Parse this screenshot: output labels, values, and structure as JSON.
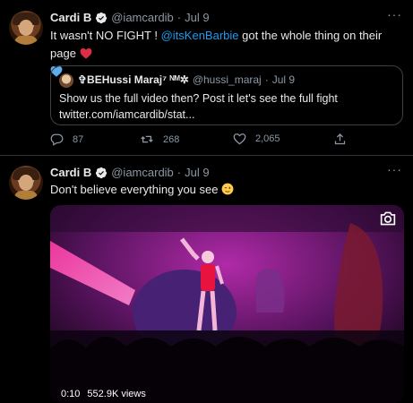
{
  "tweets": [
    {
      "author_name": "Cardi B",
      "handle": "@iamcardib",
      "separator": "·",
      "date": "Jul 9",
      "text_before": "It wasn't NO FIGHT ! ",
      "mention": "@itsKenBarbie",
      "text_after": " got the whole thing on their page",
      "more": "···",
      "quote": {
        "author_name": "✞BEHussi Maraj⁷ ᴺᴹ✲",
        "handle": "@hussi_maraj",
        "separator": "·",
        "date": "Jul 9",
        "line1": "Show us the full video then? Post it let's see the full fight",
        "line2": "twitter.com/iamcardib/stat..."
      },
      "actions": {
        "replies": "87",
        "retweets": "268",
        "likes": "2,065"
      }
    },
    {
      "author_name": "Cardi B",
      "handle": "@iamcardib",
      "separator": "·",
      "date": "Jul 9",
      "text": "Don't believe everything you see",
      "more": "···",
      "video": {
        "timestamp": "0:10",
        "views": "552.9K views"
      }
    }
  ],
  "icons": [
    "verified-badge-icon",
    "more-icon",
    "reply-icon",
    "retweet-icon",
    "like-icon",
    "share-icon",
    "camera-icon",
    "heart-emoji-red",
    "heart-emoji-blue",
    "wink-emoji"
  ],
  "colors": {
    "background": "#000000",
    "text": "#e7e9ea",
    "secondary": "#8b98a5",
    "accent": "#1d9bf0",
    "border": "#2f3336"
  }
}
